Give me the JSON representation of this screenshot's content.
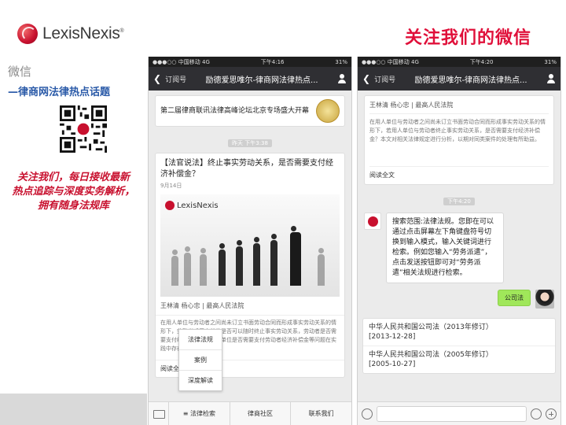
{
  "brand": {
    "name": "LexisNexis",
    "trademark": "®"
  },
  "left_panel": {
    "wechat_label": "微信",
    "subtitle": "—律商网法律热点话题",
    "promo_lines": [
      "关注我们，每日接收最新",
      "热点追踪与深度实务解析，",
      "拥有随身法规库"
    ]
  },
  "headline": "关注我们的微信",
  "phone_left": {
    "status": {
      "carrier": "●●●○○ 中国移动  4G",
      "time": "下午4:16",
      "battery": "31%"
    },
    "nav": {
      "back_label": "订阅号",
      "title": "励德爱思唯尔-律商网法律热点..."
    },
    "promo_card_title": "第二届律商联讯法律高峰论坛北京专场盛大开幕",
    "timestamp": "昨天 下午3:38",
    "article": {
      "title": "【法官说法】终止事实劳动关系，是否需要支付经济补偿金？",
      "date": "9月14日",
      "logo_text": "LexisNexis",
      "author": "王林清 杨心忠 | 最高人民法院",
      "body": "在用人单位与劳动者之间尚未订立书面劳动合同而形成事实劳动关系的情形下，劳动者或用人单位是否可以随时终止事实劳动关系，劳动者是否需要支付经济补偿金…用人单位是否需要支付劳动者经济补偿金等问题在实践中存在较大争议。",
      "read_more": "阅读全文"
    },
    "popup_menu": [
      "法律法规",
      "案例",
      "深度解读"
    ],
    "bottom_menu": [
      "≡ 法律检索",
      "律商社区",
      "联系我们"
    ]
  },
  "phone_right": {
    "status": {
      "carrier": "●●●○○ 中国移动  4G",
      "time": "下午4:20",
      "battery": "31%"
    },
    "nav": {
      "back_label": "订阅号",
      "title": "励德爱思唯尔-律商网法律热点..."
    },
    "info_card": {
      "author": "王林清 杨心忠 | 最高人民法院",
      "body": "在用人单位与劳动者之间尚未订立书面劳动合同而形成事实劳动关系的情形下，若用人单位与劳动者终止事实劳动关系，是否需要支付经济补偿金？本文对相关法律规定进行分析，以期对同类案件的处理有所助益。",
      "read": "阅读全文"
    },
    "timestamp": "下午4:20",
    "bot_message": "搜索范围:法律法规。您即在可以通过点击屏幕左下角键盘符号切换到输入模式，输入关键词进行检索。例如您输入“劳务派遣”，点击发送按钮即可对“劳务派遣”相关法规进行检索。",
    "user_message": "公司法",
    "results": [
      {
        "title": "中华人民共和国公司法（2013年修订）",
        "date": "[2013-12-28]"
      },
      {
        "title": "中华人民共和国公司法（2005年修订）",
        "date": "[2005-10-27]"
      }
    ]
  }
}
